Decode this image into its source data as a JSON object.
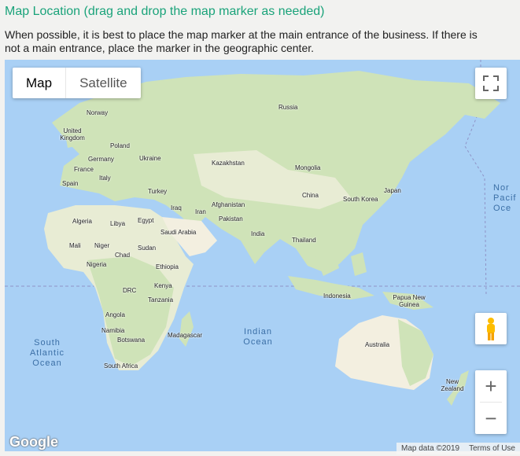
{
  "header": {
    "title": "Map Location (drag and drop the map marker as needed)",
    "description": "When possible, it is best to place the map marker at the main entrance of the business. If there is not a main entrance, place the marker in the geographic center."
  },
  "map": {
    "type_controls": {
      "map_label": "Map",
      "satellite_label": "Satellite",
      "selected": "Map"
    },
    "icons": {
      "fullscreen": "fullscreen-icon",
      "pegman": "street-view-pegman-icon",
      "zoom_in": "zoom-in-icon",
      "zoom_out": "zoom-out-icon"
    },
    "zoom_in_symbol": "+",
    "zoom_out_symbol": "−",
    "logo": "Google",
    "attribution": {
      "data": "Map data ©2019",
      "terms": "Terms of Use"
    },
    "countries": [
      "Russia",
      "Norway",
      "United Kingdom",
      "Poland",
      "Germany",
      "Ukraine",
      "France",
      "Italy",
      "Spain",
      "Turkey",
      "Kazakhstan",
      "Mongolia",
      "China",
      "Japan",
      "South Korea",
      "Iraq",
      "Iran",
      "Afghanistan",
      "Pakistan",
      "India",
      "Thailand",
      "Algeria",
      "Libya",
      "Egypt",
      "Saudi Arabia",
      "Mali",
      "Niger",
      "Chad",
      "Sudan",
      "Nigeria",
      "Ethiopia",
      "Kenya",
      "DRC",
      "Tanzania",
      "Angola",
      "Namibia",
      "Botswana",
      "Madagascar",
      "South Africa",
      "Indonesia",
      "Papua New Guinea",
      "Australia",
      "New Zealand"
    ],
    "oceans": {
      "indian": "Indian Ocean",
      "south_atlantic": "South Atlantic Ocean",
      "north_pacific_partial": "Nor Pacif Oce"
    },
    "colors": {
      "water": "#a9d0f5",
      "land": "#e8ecd4",
      "vegetation": "#cfe3b8",
      "desert": "#f3efe0",
      "title": "#1aa37a"
    }
  }
}
